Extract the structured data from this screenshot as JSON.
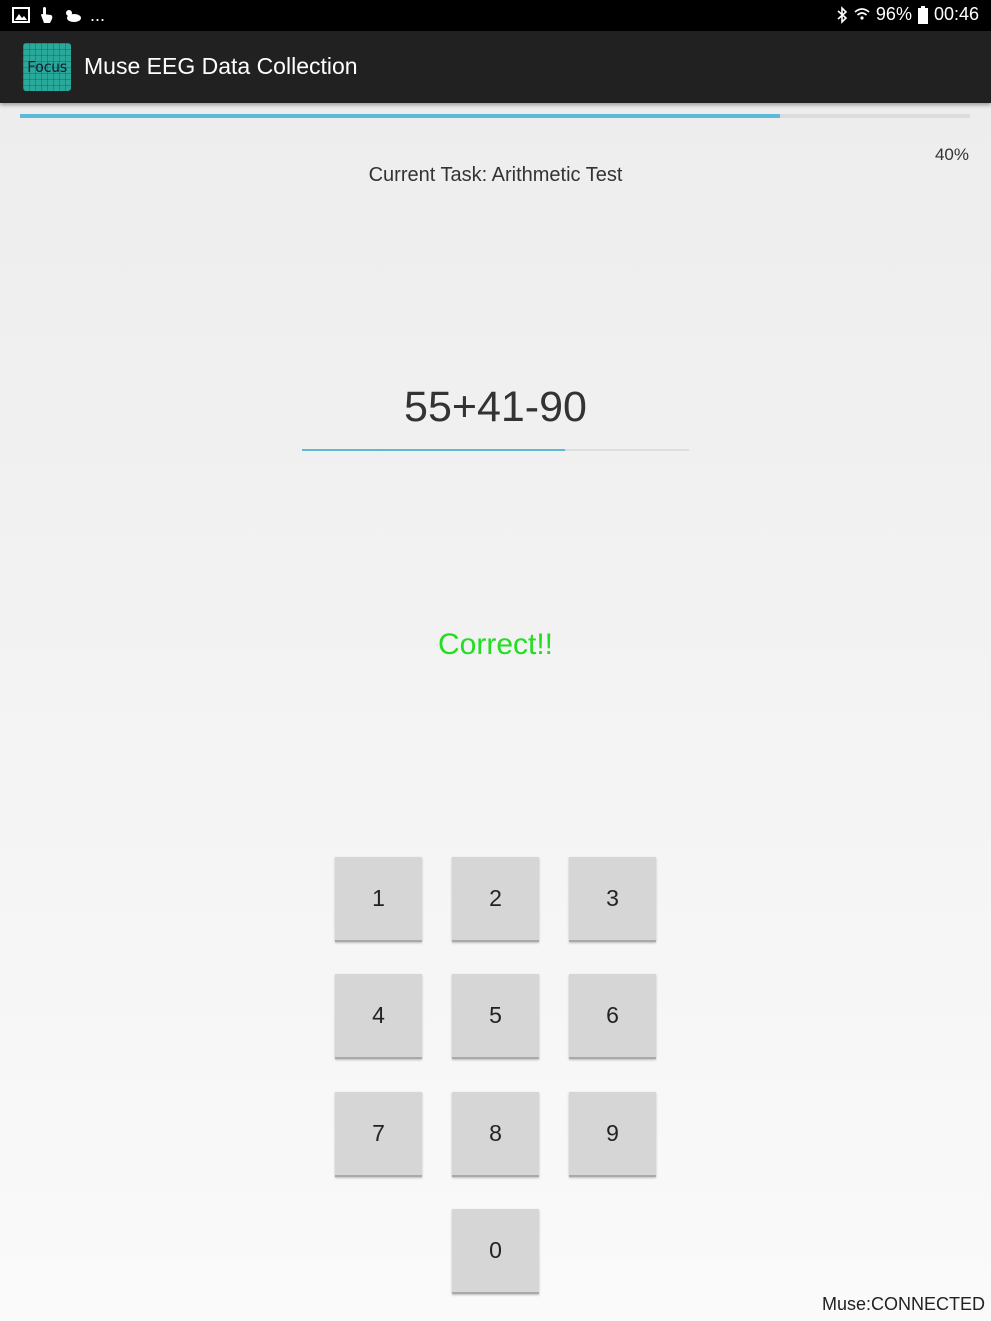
{
  "status_bar": {
    "icons_left": [
      "image-icon",
      "touch-icon",
      "weather-icon"
    ],
    "ellipsis": "...",
    "icons_right": [
      "bluetooth-icon",
      "wifi-icon"
    ],
    "battery": "96%",
    "time": "00:46"
  },
  "app_bar": {
    "icon_text": "Focus",
    "title": "Muse EEG Data Collection",
    "icon_color": "#2aa89a"
  },
  "task": {
    "progress_percent": 80,
    "progress_label": "40%",
    "prefix": "Current Task:",
    "name": "Arithmetic Test"
  },
  "question": {
    "expression": "55+41-90",
    "answer_value": "",
    "answer_line_fill_percent": 68
  },
  "feedback": {
    "text": "Correct!!",
    "color": "#22dd22"
  },
  "keypad": {
    "keys": [
      "1",
      "2",
      "3",
      "4",
      "5",
      "6",
      "7",
      "8",
      "9",
      "0"
    ]
  },
  "footer": {
    "muse_label": "Muse:",
    "muse_state": "CONNECTED"
  }
}
